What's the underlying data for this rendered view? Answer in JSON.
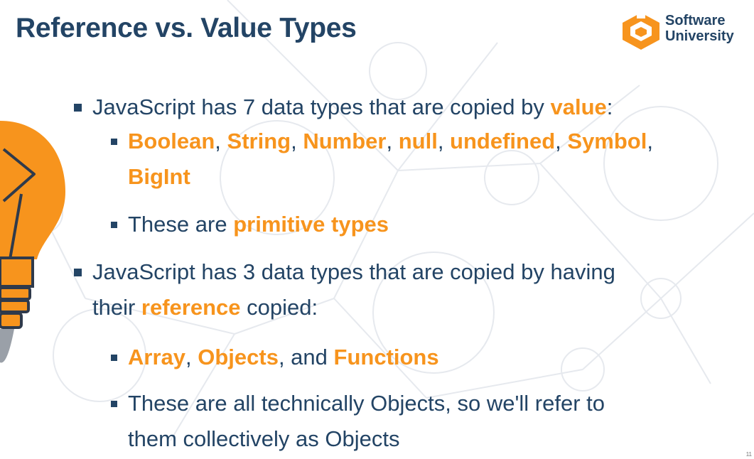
{
  "slide": {
    "title": "Reference vs. Value Types"
  },
  "logo": {
    "line1": "Software",
    "line2": "University",
    "icon": "softuni-logo-icon"
  },
  "decor": {
    "icon": "lightbulb-icon",
    "accent_color": "#f7941d",
    "text_color": "#234465"
  },
  "bullets": {
    "b1": {
      "prefix": "JavaScript has 7 data types that are copied by ",
      "value_word": "value",
      "suffix": ":"
    },
    "b1_1": {
      "types": [
        "Boolean",
        "String",
        "Number",
        "null",
        "undefined",
        "Symbol",
        "BigInt"
      ],
      "sep": ", "
    },
    "b1_2": {
      "prefix": "These are ",
      "highlight": "primitive types"
    },
    "b2": {
      "line1": "JavaScript has 3 data types that are copied by having",
      "prefix2": "their ",
      "highlight": "reference",
      "suffix2": " copied:"
    },
    "b2_1": {
      "item1": "Array",
      "sep1": ", ",
      "item2": "Objects",
      "sep2": ", and ",
      "item3": "Functions"
    },
    "b2_2": {
      "line1": "These are all technically Objects, so we'll refer to",
      "line2": "them collectively as Objects"
    }
  },
  "page_number": "11"
}
